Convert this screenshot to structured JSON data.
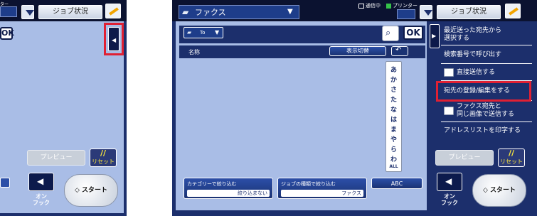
{
  "left_panel": {
    "printer_label": "ター",
    "job_status_label": "ジョブ状況",
    "ok_label": "OK",
    "preview_label": "プレビュー",
    "reset_label": "リセット",
    "onhook_label_1": "オン",
    "onhook_label_2": "フック",
    "start_label": "スタート"
  },
  "header": {
    "mode": "ファクス",
    "status_comm": "通信中",
    "printer_label": "プリンター",
    "job_status_label": "ジョブ状況"
  },
  "address_book": {
    "to_label": "To",
    "ok_label": "OK",
    "name_column": "名称",
    "toggle_label": "表示切替",
    "kana_index": [
      "あ",
      "か",
      "さ",
      "た",
      "な",
      "は",
      "ま",
      "や",
      "ら",
      "わ",
      "ALL"
    ],
    "filter_category": {
      "title": "カテゴリーで絞り込む",
      "value": "絞り込まない"
    },
    "filter_job": {
      "title": "ジョブの種類で絞り込む",
      "value": "ファクス"
    },
    "abc_label": "ABC"
  },
  "actions": {
    "items": [
      {
        "line1": "最近送った宛先から",
        "line2": "選択する"
      },
      {
        "line1": "検索番号で呼び出す",
        "line2": ""
      },
      {
        "line1": "直接送信する",
        "line2": ""
      },
      {
        "line1": "宛先の登録/編集をする",
        "line2": ""
      },
      {
        "line1": "ファクス宛先と",
        "line2": "同じ画像で送信する"
      },
      {
        "line1": "アドレスリストを印字する",
        "line2": ""
      }
    ]
  },
  "bottom": {
    "preview_label": "プレビュー",
    "reset_label": "リセット",
    "onhook_label_1": "オン",
    "onhook_label_2": "フック",
    "start_label": "スタート"
  },
  "colors": {
    "navy": "#1c2f6c",
    "light_blue": "#a9bde6",
    "highlight_red": "#e02033"
  }
}
